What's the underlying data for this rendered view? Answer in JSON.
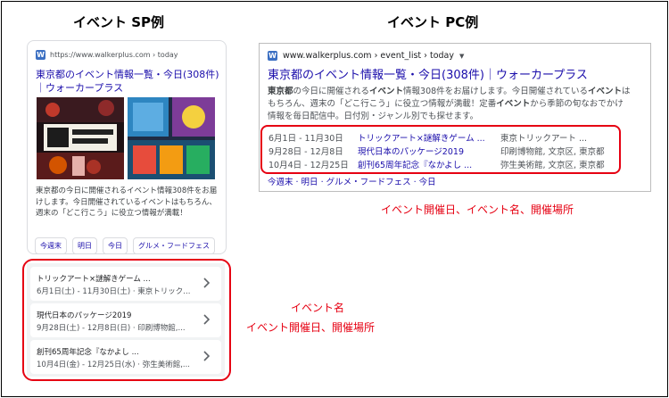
{
  "sp": {
    "heading": "イベント SP例",
    "favicon": "W",
    "url": "https://www.walkerplus.com › today",
    "title": "東京都のイベント情報一覧・今日(308件)｜ウォーカープラス",
    "description": "東京都の今日に開催されるイベント情報308件をお届けします。今日開催されているイベントはもちろん、週末の「どこ行こう」に役立つ情報が満載！",
    "chips": [
      "今週末",
      "明日",
      "今日",
      "グルメ・フードフェス"
    ],
    "events": [
      {
        "name": "トリックアート×謎解きゲーム ...",
        "meta": "6月1日(土) - 11月30日(土) · 東京トリック..."
      },
      {
        "name": "現代日本のパッケージ2019",
        "meta": "9月28日(土) - 12月8日(日) · 印刷博物館,..."
      },
      {
        "name": "創刊65周年記念『なかよし ...",
        "meta": "10月4日(金) - 12月25日(水) · 弥生美術館,..."
      }
    ],
    "caption_1": "イベント名",
    "caption_2": "イベント開催日、開催場所"
  },
  "pc": {
    "heading": "イベント PC例",
    "favicon": "W",
    "url": "www.walkerplus.com › event_list › today",
    "caret": "▼",
    "title": "東京都のイベント情報一覧・今日(308件)｜ウォーカープラス",
    "description": {
      "line1": [
        "東京都",
        "の今日に開催される",
        "イベント",
        "情報308件をお届けします。今日開催されている",
        "イベント",
        "は"
      ],
      "line2": [
        "もちろん、週末の「どこ行こう」に役立つ情報が満載！定番",
        "イベント",
        "から季節の旬なおでかけ"
      ],
      "line3": "情報を毎日配信中。日付別・ジャンル別でも探せます。"
    },
    "events": [
      {
        "date": "6月1日 - 11月30日",
        "name": "トリックアート×謎解きゲーム ...",
        "place": "東京トリックアート ..."
      },
      {
        "date": "9月28日 - 12月8日",
        "name": "現代日本のパッケージ2019",
        "place": "印刷博物館, 文京区, 東京都"
      },
      {
        "date": "10月4日 - 12月25日",
        "name": "創刊65周年記念『なかよし ...",
        "place": "弥生美術館, 文京区, 東京都"
      }
    ],
    "sitelinks": "今週末 · 明日 · グルメ・フードフェス · 今日",
    "caption": "イベント開催日、イベント名、開催場所"
  },
  "colors": {
    "link": "#1a0dab",
    "annotation": "#e60012",
    "favicon": "#3b6fc2"
  }
}
